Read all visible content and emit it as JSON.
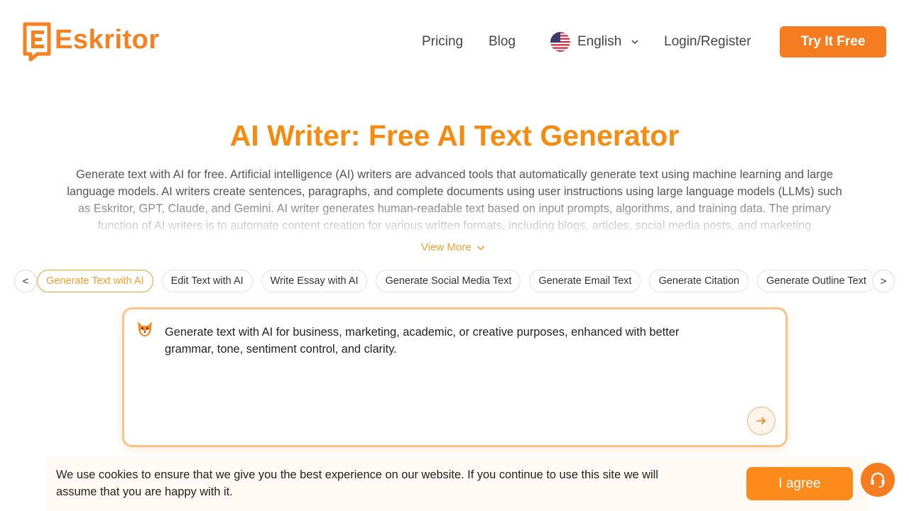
{
  "brand": {
    "name": "Eskritor",
    "accent": "#f57c1f",
    "title_color": "#f58c12"
  },
  "nav": {
    "pricing": "Pricing",
    "blog": "Blog",
    "language": "English",
    "login": "Login/Register",
    "cta": "Try It Free"
  },
  "hero": {
    "title": "AI Writer: Free AI Text Generator",
    "description": "Generate text with AI for free. Artificial intelligence (AI) writers are advanced tools that automatically generate text using machine learning and large language models. AI writers create sentences, paragraphs, and complete documents using user instructions using large language models (LLMs) such as Eskritor, GPT, Claude, and Gemini. AI writer generates human-readable text based on input prompts, algorithms, and training data. The primary function of AI writers is to automate content creation for various written formats, including blogs, articles, social media posts, and marketing",
    "view_more": "View More"
  },
  "chips": {
    "prev": "<",
    "next": ">",
    "items": [
      {
        "label": "Generate Text with AI",
        "active": true
      },
      {
        "label": "Edit Text with AI",
        "active": false
      },
      {
        "label": "Write Essay with AI",
        "active": false
      },
      {
        "label": "Generate Social Media Text",
        "active": false
      },
      {
        "label": "Generate Email Text",
        "active": false
      },
      {
        "label": "Generate Citation",
        "active": false
      },
      {
        "label": "Generate Outline Text",
        "active": false
      }
    ]
  },
  "prompt": {
    "icon": "fox-mascot-icon",
    "placeholder": "Generate text with AI for business, marketing, academic, or creative purposes, enhanced with better grammar, tone, sentiment control, and clarity.",
    "send_icon": "arrow-right-icon"
  },
  "cookie": {
    "message": "We use cookies to ensure that we give you the best experience on our website. If you continue to use this site we will assume that you are happy with it.",
    "agree": "I agree"
  },
  "support": {
    "icon": "headset-icon"
  }
}
